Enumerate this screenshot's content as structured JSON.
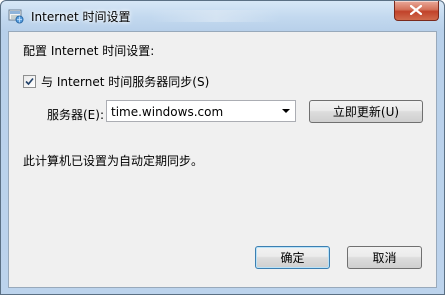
{
  "window": {
    "title": "Internet 时间设置"
  },
  "dialog": {
    "heading": "配置 Internet 时间设置:",
    "sync_checkbox": {
      "label": "与 Internet 时间服务器同步(S)",
      "checked": true
    },
    "server": {
      "label": "服务器(E):",
      "value": "time.windows.com"
    },
    "update_button": "立即更新(U)",
    "status": "此计算机已设置为自动定期同步。",
    "ok_button": "确定",
    "cancel_button": "取消"
  },
  "colors": {
    "titlebar": "#c3d9ef",
    "client_bg": "#f0f0f0",
    "close_button": "#c1422a",
    "default_button_border": "#3c7fb1"
  }
}
